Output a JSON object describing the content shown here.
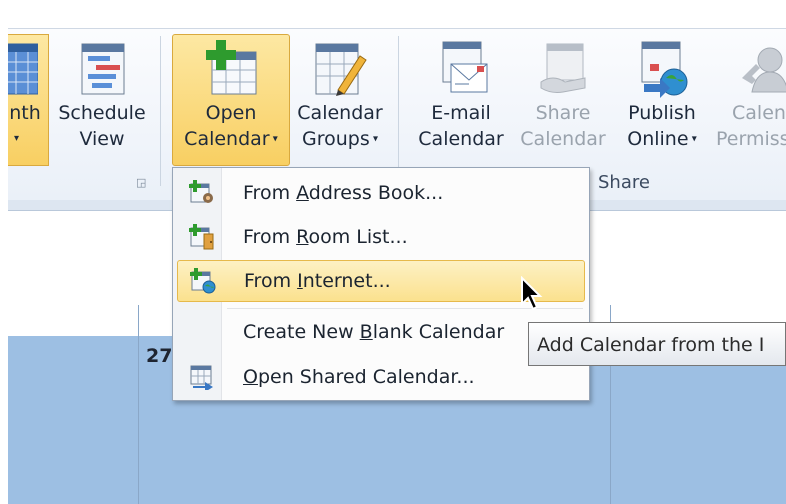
{
  "ribbon": {
    "month_partial": "nth",
    "schedule_view": [
      "Schedule",
      "View"
    ],
    "open_calendar": [
      "Open",
      "Calendar"
    ],
    "calendar_groups": [
      "Calendar",
      "Groups"
    ],
    "email_calendar": [
      "E-mail",
      "Calendar"
    ],
    "share_calendar": [
      "Share",
      "Calendar"
    ],
    "publish_online": [
      "Publish",
      "Online"
    ],
    "calendar_permissions_partial": [
      "Calen",
      "Permiss"
    ],
    "group_share_label": "Share"
  },
  "menu": {
    "items": [
      {
        "pre": "From ",
        "key": "A",
        "post": "ddress Book..."
      },
      {
        "pre": "From ",
        "key": "R",
        "post": "oom List..."
      },
      {
        "pre": "From ",
        "key": "I",
        "post": "nternet..."
      },
      {
        "pre": "Create New ",
        "key": "B",
        "post": "lank Calendar"
      },
      {
        "pre": "",
        "key": "O",
        "post": "pen Shared Calendar..."
      }
    ]
  },
  "tooltip": "Add Calendar from the I",
  "calendar": {
    "day_number": "27"
  },
  "colors": {
    "ribbon_highlight": "#f8cf62",
    "calendar_fill": "#9dbfe3",
    "menu_hover": "#fbe18e"
  }
}
